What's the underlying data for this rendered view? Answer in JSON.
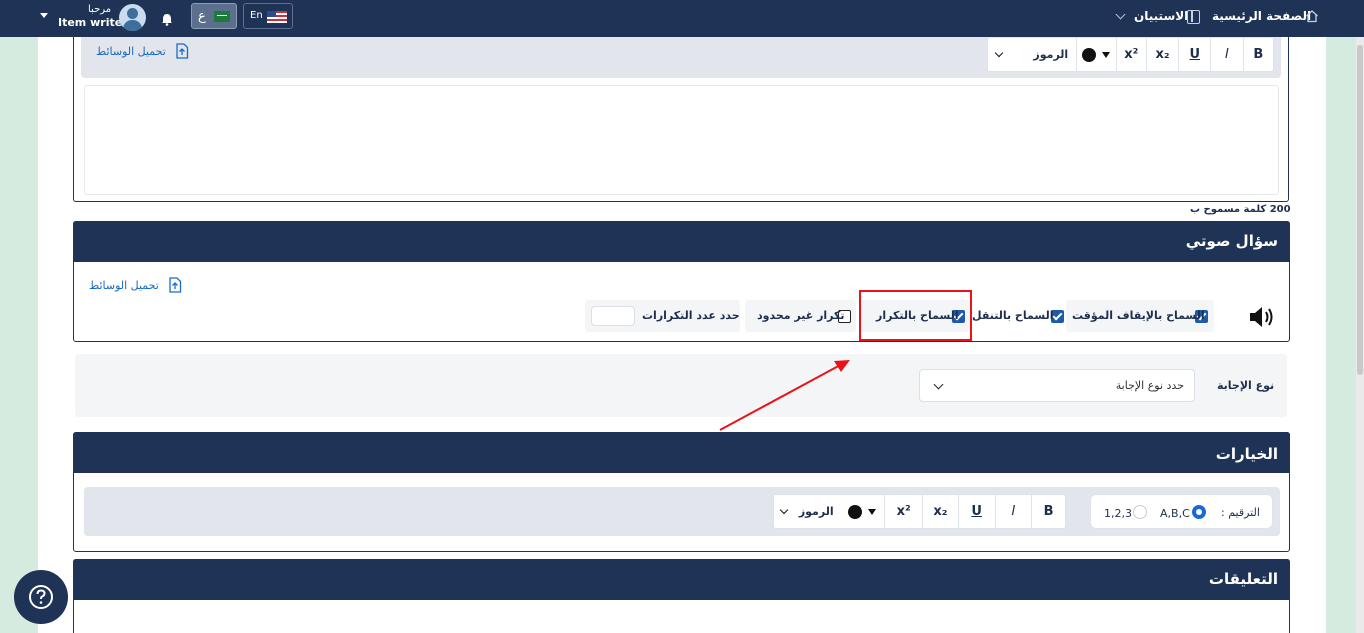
{
  "topbar": {
    "home": "الصفحة الرئيسية",
    "questionnaire": "الاستبيان",
    "greeting": "مرحبا",
    "user_name": "Item writer",
    "lang_en": "En",
    "lang_ar": "ع"
  },
  "editor": {
    "upload_media": "تحميل الوسائط",
    "symbols": "الرموز",
    "bold": "B",
    "italic": "I",
    "underline": "U",
    "subscript": "x₂",
    "superscript": "x²",
    "word_limit": "200 كلمة مسموح ب"
  },
  "audio_question": {
    "title": "سؤال صوتي",
    "upload_media": "تحميل الوسائط",
    "options": [
      {
        "label": "السماح بالإيقاف المؤقت",
        "checked": true
      },
      {
        "label": "السماح بالتنقل",
        "checked": true
      },
      {
        "label": "السماح بالتكرار",
        "checked": true
      },
      {
        "label": "تكرار غير محدود",
        "checked": false
      }
    ],
    "repeat_limit_label": "حدد عدد التكرارات",
    "repeat_limit_value": ""
  },
  "answer_type": {
    "label": "نوع الإجابة",
    "placeholder": "حدد نوع الإجابة"
  },
  "choices": {
    "title": "الخيارات",
    "numbering_label": "الترقيم :",
    "numbering_options": [
      {
        "label": "A,B,C",
        "selected": true
      },
      {
        "label": "1,2,3",
        "selected": false
      }
    ],
    "symbols": "الرموز",
    "bold": "B",
    "italic": "I",
    "underline": "U",
    "subscript": "x₂",
    "superscript": "x²"
  },
  "comments": {
    "title": "التعليقات"
  },
  "colors": {
    "navy": "#1e3356",
    "highlight": "#e8141a",
    "link": "#1a6ac9",
    "background": "#d6ebdf"
  }
}
